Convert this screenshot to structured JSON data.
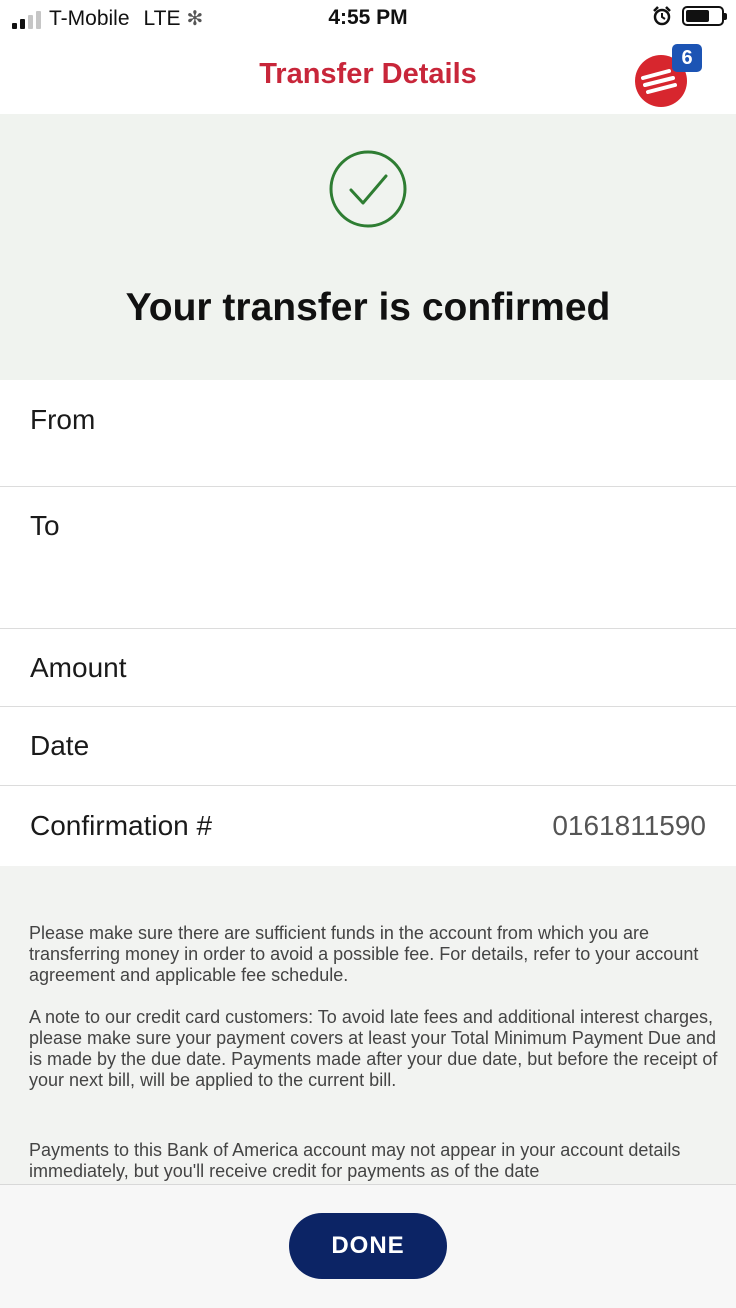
{
  "status_bar": {
    "carrier": "T-Mobile",
    "network": "LTE",
    "time": "4:55 PM"
  },
  "header": {
    "title": "Transfer Details",
    "notification_count": "6",
    "help_icon": "bank-of-america-flag-icon",
    "accent_color": "#c8263a"
  },
  "confirmation": {
    "icon": "check-circle-icon",
    "title": "Your transfer is confirmed"
  },
  "details": {
    "from_label": "From",
    "to_label": "To",
    "amount_label": "Amount",
    "date_label": "Date",
    "confirmation_label": "Confirmation #",
    "confirmation_value": "0161811590"
  },
  "notes": {
    "paragraph_1": "Please make sure there are sufficient funds in the account from which you are transferring money in order to avoid a possible fee. For details, refer to your account agreement and applicable fee schedule.",
    "paragraph_2": "A note to our credit card customers: To avoid late fees and additional interest charges, please make sure your payment covers at least your Total Minimum Payment Due and is made by the due date. Payments made after your due date, but before the receipt of your next bill, will be applied to the current bill.",
    "paragraph_3": "Payments to this Bank of America account may not appear in your account details immediately, but you'll receive credit for payments as of the date"
  },
  "footer": {
    "done_label": "DONE",
    "button_color": "#0c2465"
  }
}
